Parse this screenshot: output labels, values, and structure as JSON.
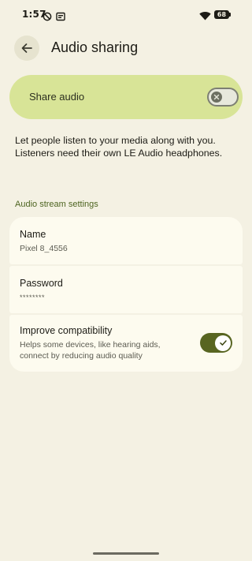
{
  "status_bar": {
    "time": "1:57",
    "battery": "68",
    "icons": [
      "do-not-disturb-icon",
      "screen-cast-icon",
      "wifi-icon",
      "battery-icon"
    ]
  },
  "toolbar": {
    "back_icon": "arrow-back-icon",
    "title": "Audio sharing"
  },
  "main_switch": {
    "label": "Share audio",
    "checked": false
  },
  "description": "Let people listen to your media along with you. Listeners need their own LE Audio headphones.",
  "section": {
    "header": "Audio stream settings",
    "items": [
      {
        "title": "Name",
        "summary": "Pixel 8_4556"
      },
      {
        "title": "Password",
        "summary": "********"
      },
      {
        "title": "Improve compatibility",
        "summary": "Helps some devices, like hearing aids, connect by reducing audio quality",
        "checked": true
      }
    ]
  },
  "colors": {
    "background": "#f4f1e3",
    "main_switch_bg": "#d8e497",
    "accent": "#586521",
    "section_header": "#4d6420",
    "card": "#fdfbef"
  }
}
